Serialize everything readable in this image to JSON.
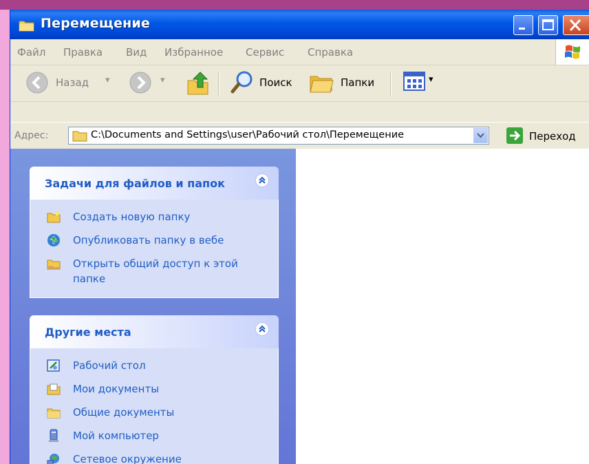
{
  "window": {
    "title": "Перемещение"
  },
  "menu": [
    "Файл",
    "Правка",
    "Вид",
    "Избранное",
    "Сервис",
    "Справка"
  ],
  "toolbar": {
    "back_label": "Назад",
    "search_label": "Поиск",
    "folders_label": "Папки"
  },
  "address": {
    "label": "Адрес:",
    "value": "C:\\Documents and Settings\\user\\Рабочий стол\\Перемещение",
    "go_label": "Переход"
  },
  "tasks_panel": {
    "title": "Задачи для файлов и папок",
    "items": [
      {
        "label": "Создать новую папку",
        "icon": "new-folder-icon"
      },
      {
        "label": "Опубликовать папку в вебе",
        "icon": "web-publish-icon"
      },
      {
        "label_line1": "Открыть общий доступ к этой",
        "label_line2": "папке",
        "icon": "share-folder-icon"
      }
    ]
  },
  "places_panel": {
    "title": "Другие места",
    "items": [
      {
        "label": "Рабочий стол",
        "icon": "desktop-icon"
      },
      {
        "label": "Мои документы",
        "icon": "my-documents-icon"
      },
      {
        "label": "Общие документы",
        "icon": "shared-documents-icon"
      },
      {
        "label": "Мой компьютер",
        "icon": "my-computer-icon"
      },
      {
        "label": "Сетевое окружение",
        "icon": "network-icon"
      }
    ]
  },
  "colors": {
    "titlebar": "#0058e6",
    "task_link": "#215dc6",
    "taskpane_bg": "#7a96df",
    "panel_body": "#d6dff7"
  }
}
